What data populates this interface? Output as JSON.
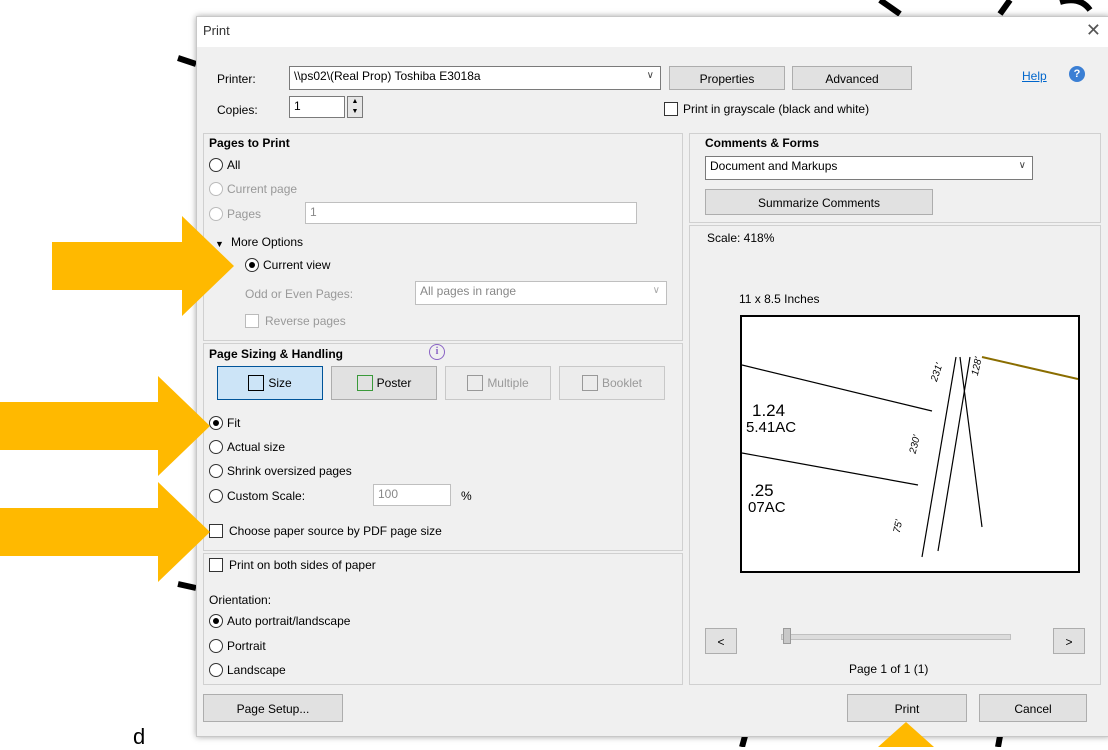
{
  "dialog": {
    "title": "Print",
    "close_glyph": "✕",
    "help_label": "Help",
    "help_icon_glyph": "?"
  },
  "printer": {
    "label": "Printer:",
    "value": "\\\\ps02\\(Real Prop) Toshiba E3018a",
    "properties_label": "Properties",
    "advanced_label": "Advanced",
    "copies_label": "Copies:",
    "copies_value": "1",
    "grayscale_label": "Print in grayscale (black and white)",
    "grayscale_checked": false
  },
  "pages_to_print": {
    "header": "Pages to Print",
    "all_label": "All",
    "current_page_label": "Current page",
    "pages_label": "Pages",
    "pages_value": "1",
    "more_options_label": "More Options",
    "current_view_label": "Current view",
    "odd_even_label": "Odd or Even Pages:",
    "odd_even_value": "All pages in range",
    "reverse_label": "Reverse pages"
  },
  "sizing": {
    "header": "Page Sizing & Handling",
    "info_glyph": "i",
    "size_label": "Size",
    "poster_label": "Poster",
    "multiple_label": "Multiple",
    "booklet_label": "Booklet",
    "fit_label": "Fit",
    "actual_label": "Actual size",
    "shrink_label": "Shrink oversized pages",
    "custom_label": "Custom Scale:",
    "custom_value": "100",
    "percent": "%",
    "paper_source_label": "Choose paper source by PDF page size",
    "duplex_label": "Print on both sides of paper",
    "orientation_label": "Orientation:",
    "auto_label": "Auto portrait/landscape",
    "portrait_label": "Portrait",
    "landscape_label": "Landscape"
  },
  "comments": {
    "header": "Comments & Forms",
    "value": "Document and Markups",
    "summarize_label": "Summarize Comments",
    "scale_label": "Scale: 418%",
    "paper_size": "11 x 8.5 Inches",
    "prev_glyph": "<",
    "next_glyph": ">",
    "page_status": "Page 1 of 1 (1)",
    "preview_text": [
      "1.24",
      "5.41AC",
      ".25",
      "07AC",
      "231'",
      "128'",
      "230'",
      "75'"
    ]
  },
  "footer": {
    "page_setup_label": "Page Setup...",
    "print_label": "Print",
    "cancel_label": "Cancel"
  },
  "background": {
    "stray_letter": "d"
  },
  "colors": {
    "arrow": "#ffb900",
    "selected_tile": "#cce4f7",
    "link": "#0066cc"
  }
}
